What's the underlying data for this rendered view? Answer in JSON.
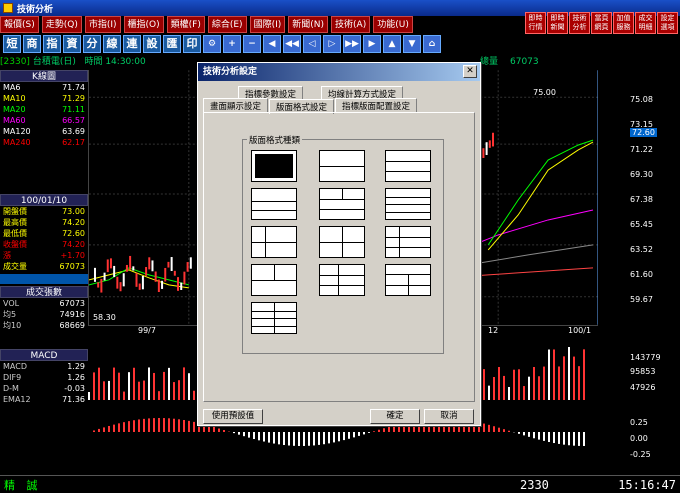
{
  "window": {
    "title": "技術分析"
  },
  "menu": [
    "報價(S)",
    "走勢(Q)",
    "市指(I)",
    "櫃指(O)",
    "類權(F)",
    "綜合(E)",
    "國際(I)",
    "新聞(N)",
    "技術(A)",
    "功能(U)"
  ],
  "quickbar": [
    "即時行情",
    "即時新聞",
    "技術分析",
    "當頁網頁",
    "加值服務",
    "成交明細",
    "設定選項"
  ],
  "toolbar": [
    "短",
    "商",
    "指",
    "資",
    "分",
    "線",
    "連",
    "設",
    "匯",
    "印"
  ],
  "infobar": {
    "code": "[2330]",
    "name": "台積電(日)",
    "time_label": "時間",
    "time": "14:30:00",
    "total_label": "總量",
    "total": "67073"
  },
  "left": {
    "title": "K線圖",
    "ma": [
      {
        "n": "MA6",
        "v": "71.74",
        "c": "#fff"
      },
      {
        "n": "MA10",
        "v": "71.29",
        "c": "#ff0"
      },
      {
        "n": "MA20",
        "v": "71.11",
        "c": "#0f0"
      },
      {
        "n": "MA60",
        "v": "66.57",
        "c": "#f0f"
      },
      {
        "n": "MA120",
        "v": "63.69",
        "c": "#fff"
      },
      {
        "n": "MA240",
        "v": "62.17",
        "c": "#f00"
      }
    ],
    "date": "100/01/10",
    "prices": [
      {
        "n": "開盤價",
        "v": "73.00",
        "c": "#ff0"
      },
      {
        "n": "最高價",
        "v": "74.20",
        "c": "#ff0"
      },
      {
        "n": "最低價",
        "v": "72.60",
        "c": "#ff0"
      },
      {
        "n": "收盤價",
        "v": "74.20",
        "c": "#f00"
      },
      {
        "n": "漲",
        "v": "+1.70",
        "c": "#f00"
      },
      {
        "n": "成交量",
        "v": "67073",
        "c": "#ff0"
      }
    ],
    "vol_title": "成交張數",
    "vol": [
      {
        "n": "VOL",
        "v": "67073"
      },
      {
        "n": "均5",
        "v": "74916"
      },
      {
        "n": "均10",
        "v": "68669"
      }
    ],
    "macd_title": "MACD",
    "macd": [
      {
        "n": "MACD",
        "v": "1.29"
      },
      {
        "n": "DIF9",
        "v": "1.26"
      },
      {
        "n": "D-M",
        "v": "-0.03"
      },
      {
        "n": "EMA12",
        "v": "71.36"
      }
    ]
  },
  "axis": {
    "price": [
      "75.08",
      "73.15",
      "72.60",
      "71.22",
      "69.30",
      "67.38",
      "65.45",
      "63.52",
      "61.60",
      "59.67"
    ],
    "vol": [
      "143779",
      "95853",
      "47926"
    ],
    "macd": [
      "0.25",
      "0.00",
      "-0.25"
    ],
    "x": [
      "99/7",
      "12",
      "100/1"
    ],
    "peak": "75.00",
    "low": "58.30"
  },
  "dialog": {
    "title": "技術分析設定",
    "tabs_top": [
      "指標參數設定",
      "均線計算方式設定"
    ],
    "tabs_bottom": [
      "畫面顯示設定",
      "版面格式設定",
      "指標版面配置設定"
    ],
    "group": "版面格式種類",
    "buttons": {
      "default": "使用預設值",
      "ok": "確定",
      "cancel": "取消"
    }
  },
  "status": {
    "left": "精 誠",
    "stock": "2330",
    "clock": "15:16:47"
  }
}
